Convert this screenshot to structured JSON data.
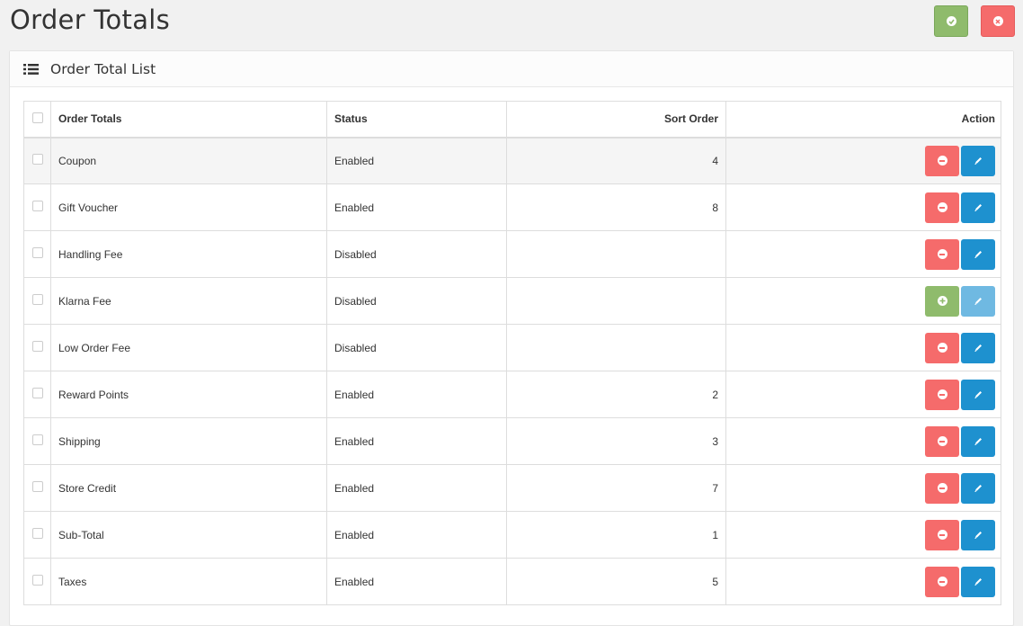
{
  "page": {
    "title": "Order Totals"
  },
  "panel": {
    "title": "Order Total List"
  },
  "table": {
    "headers": {
      "name": "Order Totals",
      "status": "Status",
      "sort_order": "Sort Order",
      "action": "Action"
    },
    "rows": [
      {
        "name": "Coupon",
        "status": "Enabled",
        "sort_order": "4",
        "installed": true
      },
      {
        "name": "Gift Voucher",
        "status": "Enabled",
        "sort_order": "8",
        "installed": true
      },
      {
        "name": "Handling Fee",
        "status": "Disabled",
        "sort_order": "",
        "installed": true
      },
      {
        "name": "Klarna Fee",
        "status": "Disabled",
        "sort_order": "",
        "installed": false
      },
      {
        "name": "Low Order Fee",
        "status": "Disabled",
        "sort_order": "",
        "installed": true
      },
      {
        "name": "Reward Points",
        "status": "Enabled",
        "sort_order": "2",
        "installed": true
      },
      {
        "name": "Shipping",
        "status": "Enabled",
        "sort_order": "3",
        "installed": true
      },
      {
        "name": "Store Credit",
        "status": "Enabled",
        "sort_order": "7",
        "installed": true
      },
      {
        "name": "Sub-Total",
        "status": "Enabled",
        "sort_order": "1",
        "installed": true
      },
      {
        "name": "Taxes",
        "status": "Enabled",
        "sort_order": "5",
        "installed": true
      }
    ]
  },
  "colors": {
    "danger": "#f56b6b",
    "success": "#8fbb6c",
    "primary": "#1e91cf",
    "primary_disabled": "#6fb9e2"
  },
  "icons": {
    "save": "check-circle-icon",
    "cancel": "times-circle-icon",
    "list": "list-icon",
    "uninstall": "minus-circle-icon",
    "install": "plus-circle-icon",
    "edit": "pencil-icon"
  }
}
